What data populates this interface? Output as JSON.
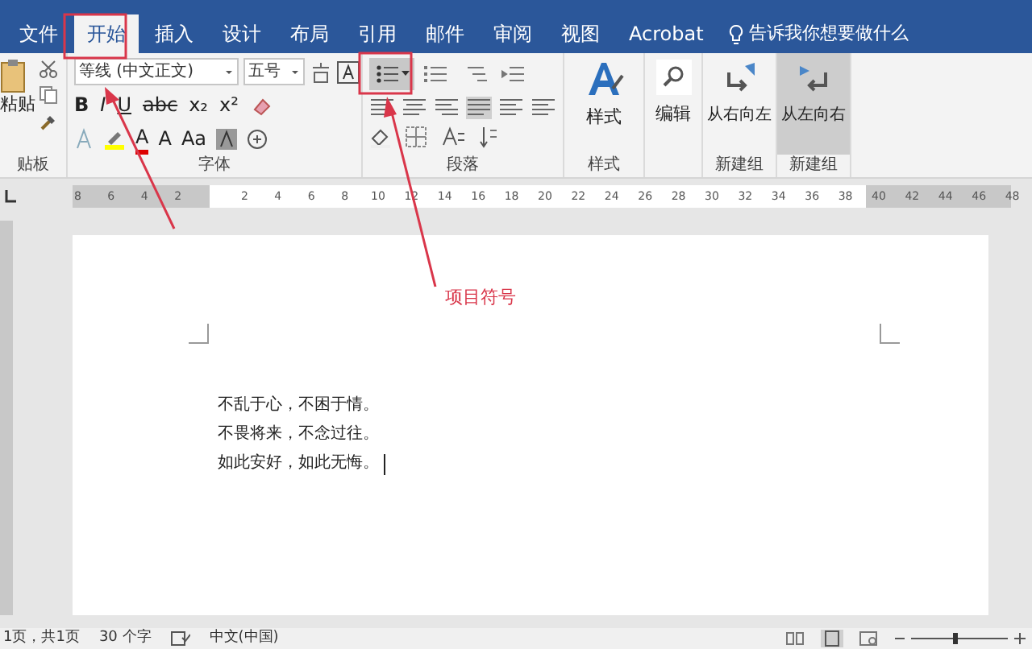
{
  "tabs": [
    {
      "label": "文件",
      "selected": false
    },
    {
      "label": "开始",
      "selected": true
    },
    {
      "label": "插入",
      "selected": false
    },
    {
      "label": "设计",
      "selected": false
    },
    {
      "label": "布局",
      "selected": false
    },
    {
      "label": "引用",
      "selected": false
    },
    {
      "label": "邮件",
      "selected": false
    },
    {
      "label": "审阅",
      "selected": false
    },
    {
      "label": "视图",
      "selected": false
    },
    {
      "label": "Acrobat",
      "selected": false
    }
  ],
  "tell_me": "告诉我你想要做什么",
  "ribbon": {
    "clipboard": {
      "paste": "粘贴",
      "label": "贴板"
    },
    "font": {
      "name": "等线 (中文正文)",
      "size": "五号",
      "format_buttons": [
        "B",
        "I",
        "U",
        "abc",
        "x₂",
        "x²"
      ],
      "effect_buttons": [
        "A",
        "A",
        "Aa"
      ],
      "label": "字体"
    },
    "paragraph": {
      "label": "段落",
      "bullets_selected": true
    },
    "styles": {
      "button": "样式",
      "label": "样式"
    },
    "editing": {
      "button": "编辑"
    },
    "custom_groups": [
      {
        "button": "从右向左",
        "label": "新建组",
        "selected": false
      },
      {
        "button": "从左向右",
        "label": "新建组",
        "selected": true
      }
    ]
  },
  "ruler": {
    "labels": [
      "8",
      "6",
      "4",
      "2",
      "2",
      "4",
      "6",
      "8",
      "10",
      "12",
      "14",
      "16",
      "18",
      "20",
      "22",
      "24",
      "26",
      "28",
      "30",
      "32",
      "34",
      "36",
      "38",
      "40",
      "42",
      "44",
      "46",
      "48"
    ]
  },
  "document": {
    "lines": [
      "不乱于心，不困于情。",
      "不畏将来，不念过往。",
      "如此安好，如此无悔。"
    ]
  },
  "annotation": {
    "text": "项目符号"
  },
  "status_bar": {
    "page": "1页，共1页",
    "words": "30 个字",
    "language": "中文(中国)",
    "zoom": {
      "level": 0.45
    }
  }
}
